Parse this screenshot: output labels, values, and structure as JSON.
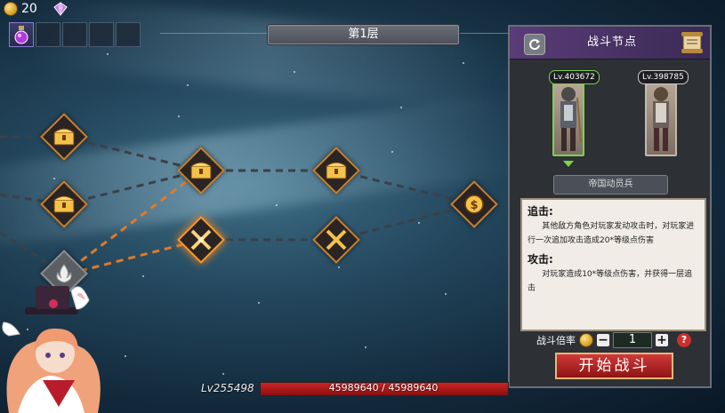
{
  "currency": {
    "value": "20"
  },
  "inventory": {
    "slots": 5
  },
  "map": {
    "floor_label": "第1层",
    "nodes": [
      {
        "id": "n1",
        "type": "chest-icon",
        "state": "normal"
      },
      {
        "id": "n2",
        "type": "chest-icon",
        "state": "normal"
      },
      {
        "id": "n3",
        "type": "campfire-icon",
        "state": "current"
      },
      {
        "id": "n4",
        "type": "chest-icon",
        "state": "normal"
      },
      {
        "id": "n5",
        "type": "battle-icon",
        "state": "active"
      },
      {
        "id": "n6",
        "type": "chest-icon",
        "state": "normal"
      },
      {
        "id": "n7",
        "type": "battle-icon",
        "state": "normal"
      },
      {
        "id": "n8",
        "type": "coin-shop-icon",
        "state": "normal"
      }
    ]
  },
  "panel": {
    "title": "战斗节点",
    "units": [
      {
        "level": "Lv.403672",
        "selected": true
      },
      {
        "level": "Lv.398785",
        "selected": false
      }
    ],
    "unit_name": "帝国动员兵",
    "skills": [
      {
        "heading": "追击:",
        "text": "其他敌方角色对玩家发动攻击时，对玩家进行一次追加攻击造成20*等级点伤害"
      },
      {
        "heading": "攻击:",
        "text": "对玩家造成10*等级点伤害，并获得一层追击"
      }
    ],
    "multiplier_label": "战斗倍率",
    "multiplier_value": "1",
    "help": "?",
    "start_button": "开始战斗"
  },
  "player": {
    "level": "Lv255498",
    "hp_text": "45989640 / 45989640",
    "hp_fraction": 1.0
  },
  "colors": {
    "accent_orange": "#ff9a2a",
    "panel_purple": "#5a3c77",
    "start_red": "#c9302c",
    "selected_green": "#7bd34a"
  }
}
